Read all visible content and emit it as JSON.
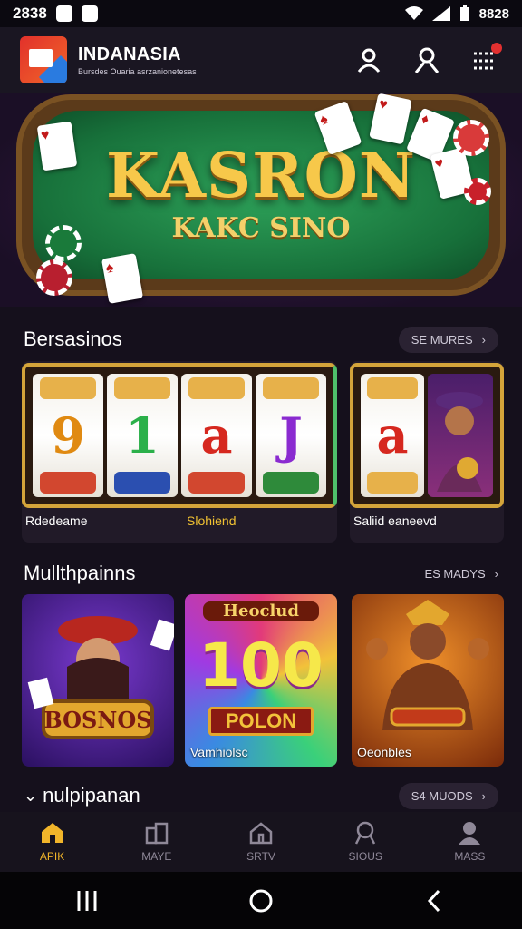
{
  "status_bar": {
    "time": "2838",
    "right_text": "8828"
  },
  "header": {
    "brand_name": "INDANASIA",
    "brand_sub": "Bursdes Ouaria asrzanionetesas"
  },
  "hero": {
    "title": "KASRON",
    "subtitle": "KAKC SINO"
  },
  "sections": {
    "slots": {
      "title": "Bersasinos",
      "more": "SE MURES"
    },
    "multi": {
      "title": "Mullthpainns",
      "more": "ES MADYS"
    },
    "third": {
      "title": "nulpipanan",
      "more": "S4 MUODS"
    }
  },
  "slots": [
    {
      "label": "Rdedeame",
      "symbols": [
        "9",
        "1",
        "a",
        "J"
      ]
    },
    {
      "label": "Slohiend"
    },
    {
      "label": "Saliid eaneevd",
      "symbols": [
        "a"
      ]
    }
  ],
  "slot_label_accent": "#f1c232",
  "multi_tiles": [
    {
      "label": "",
      "title": "BOSNOS"
    },
    {
      "label": "Vamhiolsc",
      "title": "100",
      "banner": "POLON",
      "top": "Heoclud"
    },
    {
      "label": "Oeonbles"
    }
  ],
  "bottom_nav": [
    {
      "label": "APIK",
      "icon": "home-icon",
      "active": true
    },
    {
      "label": "MAYE",
      "icon": "building-icon",
      "active": false
    },
    {
      "label": "SRTV",
      "icon": "house-icon",
      "active": false
    },
    {
      "label": "SIOUS",
      "icon": "search-icon",
      "active": false
    },
    {
      "label": "MASS",
      "icon": "profile-icon",
      "active": false
    }
  ],
  "colors": {
    "accent": "#f1b52a",
    "gold": "#d4a43a",
    "felt": "#1f8a45",
    "badge": "#e23030"
  }
}
